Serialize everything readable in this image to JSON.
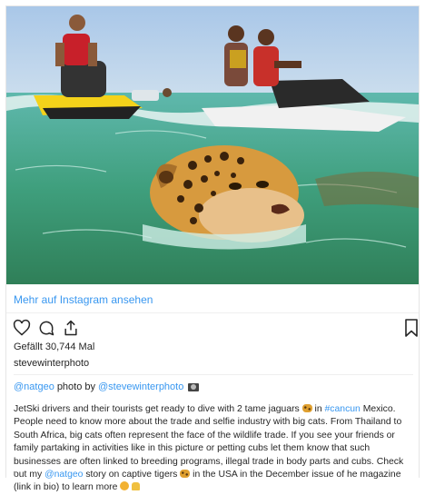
{
  "embed": {
    "view_more_label": "Mehr auf Instagram ansehen",
    "likes_text": "Gefällt 30,744 Mal",
    "author": "stevewinterphoto"
  },
  "credit": {
    "handle1": "@natgeo",
    "middle": "photo by",
    "handle2": "@stevewinterphoto",
    "icon": "camera-icon"
  },
  "caption": {
    "part1": "JetSki drivers and their tourists get ready to dive with 2 tame jaguars",
    "part2": "in",
    "hashtag": "#cancun",
    "part3": "Mexico. People need to know more about the trade and selfie industry with big cats. From Thailand to South Africa, big cats often represent the face of the wildlife trade. If you see your friends or family partaking in activities like in this picture or petting cubs let them know that such businesses are often linked to breeding programs, illegal trade in body parts and cubs. Check out my",
    "mention": "@natgeo",
    "part4": "story on captive tigers",
    "part5": "in the USA in the December issue of he magazine (link in bio) to learn more"
  },
  "icons": [
    "heart-icon",
    "comment-icon",
    "share-icon",
    "bookmark-icon",
    "leopard-emoji",
    "lion-emoji",
    "pray-emoji"
  ],
  "colors": {
    "link": "#3897f0",
    "text": "#262626",
    "border": "#e6e6e6"
  }
}
